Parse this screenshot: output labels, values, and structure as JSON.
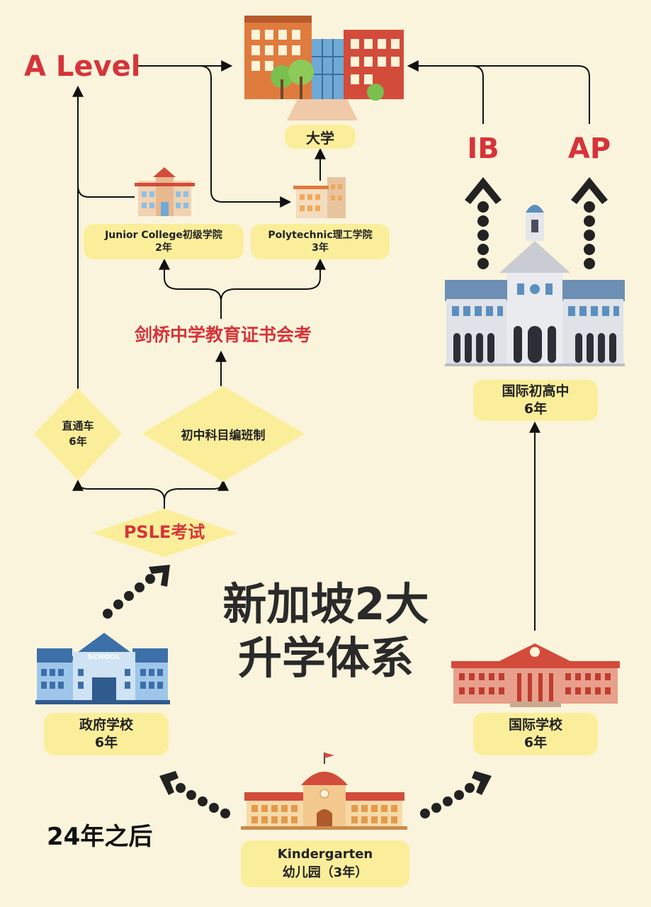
{
  "top": {
    "a_level": "A Level",
    "university": "大学"
  },
  "pre_university": {
    "jc": {
      "name": "Junior College初级学院",
      "years": "2年"
    },
    "poly": {
      "name": "Polytechnic理工学院",
      "years": "3年"
    }
  },
  "exams": {
    "o_level": "剑桥中学教育证书会考",
    "psle": "PSLE考试"
  },
  "secondary": {
    "ip": {
      "name": "直通车",
      "years": "6年"
    },
    "sbb": {
      "name": "初中科目编班制"
    }
  },
  "international": {
    "ib": "IB",
    "ap": "AP",
    "high": {
      "name": "国际初高中",
      "years": "6年"
    },
    "primary": {
      "name": "国际学校",
      "years": "6年"
    }
  },
  "government": {
    "name": "政府学校",
    "years": "6年",
    "school_sign": "SCHOOL"
  },
  "title": {
    "line1": "新加坡2大",
    "line2": "升学体系"
  },
  "kindergarten": {
    "name_en": "Kindergarten",
    "name_cn": "幼儿园（3年）"
  },
  "footer": {
    "note": "24年之后"
  },
  "colors": {
    "background": "#fbf4dc",
    "label_bg": "#fbee9a",
    "accent_red": "#d6343a",
    "text": "#222222"
  }
}
